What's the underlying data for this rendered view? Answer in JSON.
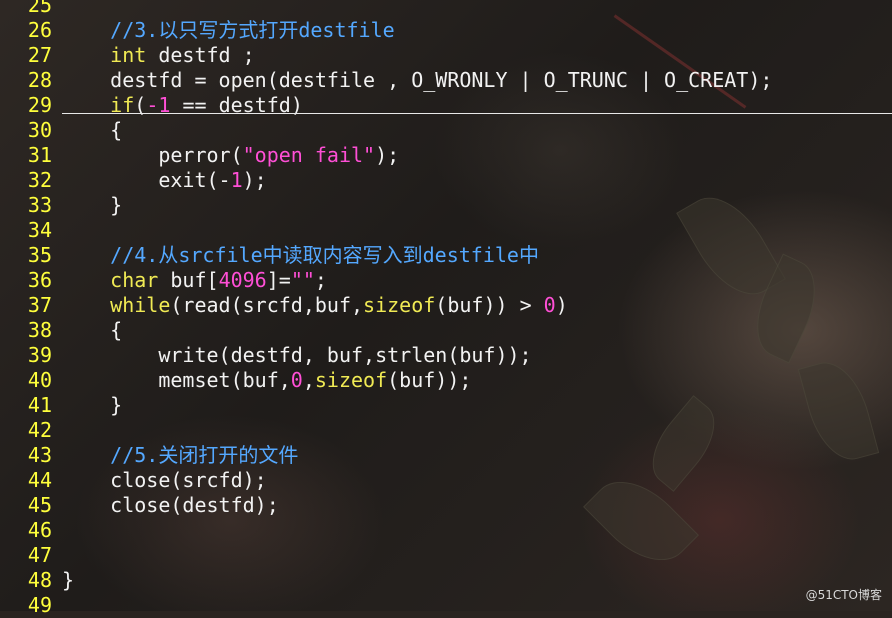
{
  "editor": {
    "lines": [
      {
        "num": "25",
        "tokens": []
      },
      {
        "num": "26",
        "tokens": [
          {
            "t": "    "
          },
          {
            "t": "//3.以只写方式打开destfile",
            "c": "comment"
          }
        ]
      },
      {
        "num": "27",
        "tokens": [
          {
            "t": "    "
          },
          {
            "t": "int",
            "c": "type"
          },
          {
            "t": " destfd ;"
          }
        ]
      },
      {
        "num": "28",
        "tokens": [
          {
            "t": "    destfd = open(destfile , O_WRONLY | O_TRUNC | O_CREAT);"
          }
        ]
      },
      {
        "num": "29",
        "tokens": [
          {
            "t": "    "
          },
          {
            "t": "if",
            "c": "kw"
          },
          {
            "t": "("
          },
          {
            "t": "-1",
            "c": "num"
          },
          {
            "t": " == destfd)"
          }
        ]
      },
      {
        "num": "30",
        "tokens": [
          {
            "t": "    {"
          }
        ]
      },
      {
        "num": "31",
        "tokens": [
          {
            "t": "        perror("
          },
          {
            "t": "\"open fail\"",
            "c": "str"
          },
          {
            "t": ");"
          }
        ]
      },
      {
        "num": "32",
        "tokens": [
          {
            "t": "        exit(-"
          },
          {
            "t": "1",
            "c": "num"
          },
          {
            "t": ");"
          }
        ]
      },
      {
        "num": "33",
        "tokens": [
          {
            "t": "    }"
          }
        ]
      },
      {
        "num": "34",
        "tokens": []
      },
      {
        "num": "35",
        "tokens": [
          {
            "t": "    "
          },
          {
            "t": "//4.从srcfile中读取内容写入到destfile中",
            "c": "comment"
          }
        ]
      },
      {
        "num": "36",
        "tokens": [
          {
            "t": "    "
          },
          {
            "t": "char",
            "c": "type"
          },
          {
            "t": " buf["
          },
          {
            "t": "4096",
            "c": "num"
          },
          {
            "t": "]="
          },
          {
            "t": "\"\"",
            "c": "str"
          },
          {
            "t": ";"
          }
        ]
      },
      {
        "num": "37",
        "tokens": [
          {
            "t": "    "
          },
          {
            "t": "while",
            "c": "kw"
          },
          {
            "t": "(read(srcfd,buf,"
          },
          {
            "t": "sizeof",
            "c": "kw"
          },
          {
            "t": "(buf)) > "
          },
          {
            "t": "0",
            "c": "num"
          },
          {
            "t": ")"
          }
        ]
      },
      {
        "num": "38",
        "tokens": [
          {
            "t": "    {"
          }
        ]
      },
      {
        "num": "39",
        "tokens": [
          {
            "t": "        write(destfd, buf,strlen(buf));"
          }
        ]
      },
      {
        "num": "40",
        "tokens": [
          {
            "t": "        memset(buf,"
          },
          {
            "t": "0",
            "c": "num"
          },
          {
            "t": ","
          },
          {
            "t": "sizeof",
            "c": "kw"
          },
          {
            "t": "(buf));"
          }
        ]
      },
      {
        "num": "41",
        "tokens": [
          {
            "t": "    }"
          }
        ]
      },
      {
        "num": "42",
        "tokens": []
      },
      {
        "num": "43",
        "tokens": [
          {
            "t": "    "
          },
          {
            "t": "//5.关闭打开的文件",
            "c": "comment"
          }
        ]
      },
      {
        "num": "44",
        "tokens": [
          {
            "t": "    close(srcfd);"
          }
        ]
      },
      {
        "num": "45",
        "tokens": [
          {
            "t": "    close(destfd);"
          }
        ]
      },
      {
        "num": "46",
        "tokens": []
      },
      {
        "num": "47",
        "tokens": []
      },
      {
        "num": "48",
        "tokens": [
          {
            "t": "}"
          }
        ]
      },
      {
        "num": "49",
        "tokens": []
      }
    ]
  },
  "watermark": "@51CTO博客",
  "colors": {
    "line_number": "#ffff3c",
    "comment": "#54a8ff",
    "keyword": "#f0ea54",
    "literal": "#ff4fd6",
    "text": "#f2f2f2"
  }
}
